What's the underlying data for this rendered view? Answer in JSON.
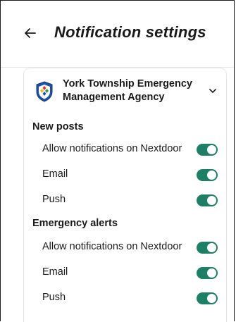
{
  "header": {
    "title": "Notification settings",
    "back_icon": "arrow-left-icon"
  },
  "agency": {
    "name": "York Township Emergency Management Agency",
    "logo_icon": "emergency-management-logo",
    "expand_icon": "chevron-down-icon"
  },
  "sections": [
    {
      "title": "New posts",
      "rows": [
        {
          "label": "Allow notifications on Nextdoor",
          "enabled": true
        },
        {
          "label": "Email",
          "enabled": true
        },
        {
          "label": "Push",
          "enabled": true
        }
      ]
    },
    {
      "title": "Emergency alerts",
      "rows": [
        {
          "label": "Allow notifications on Nextdoor",
          "enabled": true
        },
        {
          "label": "Email",
          "enabled": true
        },
        {
          "label": "Push",
          "enabled": true
        }
      ]
    }
  ],
  "colors": {
    "toggle_on": "#1d7f66"
  }
}
